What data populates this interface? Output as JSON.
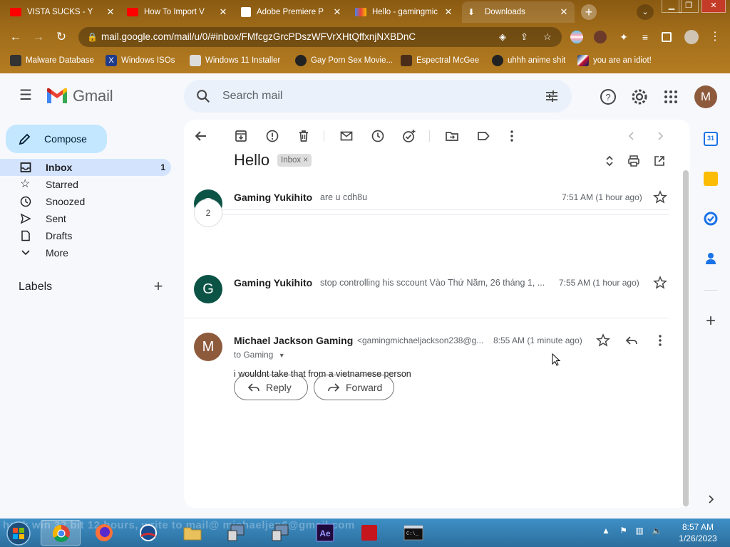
{
  "browser": {
    "tabs": [
      {
        "label": "VISTA SUCKS - Y",
        "icon": "youtube-icon",
        "color": "#ff0000"
      },
      {
        "label": "How To Import V",
        "icon": "youtube-icon",
        "color": "#ff0000"
      },
      {
        "label": "Adobe Premiere P",
        "icon": "archive-icon",
        "color": "#ffffff"
      },
      {
        "label": "Hello - gamingmic",
        "icon": "gmail-icon",
        "color": "#ea4335"
      },
      {
        "label": "Downloads",
        "icon": "download-icon",
        "color": "#ffffff"
      }
    ],
    "url": "mail.google.com/mail/u/0/#inbox/FMfcgzGrcPDszWFVrXHtQffxnjNXBDnC",
    "bookmarks": [
      "Malware Database",
      "Windows ISOs",
      "Windows 11 Installer",
      "Gay Porn Sex Movie...",
      "Espectral McGee",
      "uhhh anime shit",
      "you are an idiot!"
    ]
  },
  "gmail": {
    "product_name": "Gmail",
    "search_placeholder": "Search mail",
    "avatar_letter": "M",
    "compose_label": "Compose",
    "nav": [
      {
        "label": "Inbox",
        "count": "1",
        "icon": "inbox-icon",
        "active": true
      },
      {
        "label": "Starred",
        "count": "",
        "icon": "star-icon",
        "active": false
      },
      {
        "label": "Snoozed",
        "count": "",
        "icon": "clock-icon",
        "active": false
      },
      {
        "label": "Sent",
        "count": "",
        "icon": "send-icon",
        "active": false
      },
      {
        "label": "Drafts",
        "count": "",
        "icon": "draft-icon",
        "active": false
      },
      {
        "label": "More",
        "count": "",
        "icon": "chevron-down-icon",
        "active": false
      }
    ],
    "labels_heading": "Labels",
    "thread": {
      "subject": "Hello",
      "label_chip": "Inbox",
      "label_chip_close": "×",
      "collapsed_count": "2",
      "messages": [
        {
          "avatar": "G",
          "avatar_color": "#0b5345",
          "sender": "Gaming Yukihito",
          "snippet": "are u cdh8u",
          "time": "7:51 AM (1 hour ago)"
        },
        {
          "avatar": "G",
          "avatar_color": "#0b5345",
          "sender": "Gaming Yukihito",
          "snippet": "stop controlling his sccount Vào Thứ Năm, 26 tháng 1, ...",
          "time": "7:55 AM (1 hour ago)"
        },
        {
          "avatar": "M",
          "avatar_color": "#8e5a3c",
          "sender": "Michael Jackson Gaming",
          "email": "<gamingmichaeljackson238@g...",
          "time": "8:55 AM (1 minute ago)",
          "to": "to Gaming",
          "body": "i wouldnt take that from a vietnamese person"
        }
      ],
      "reply_label": "Reply",
      "forward_label": "Forward"
    }
  },
  "taskbar": {
    "ghost_text": "hack win 32 bit 12 hours, write to mail@ michaeljen6@gmail.com",
    "time": "8:57 AM",
    "date": "1/26/2023"
  }
}
